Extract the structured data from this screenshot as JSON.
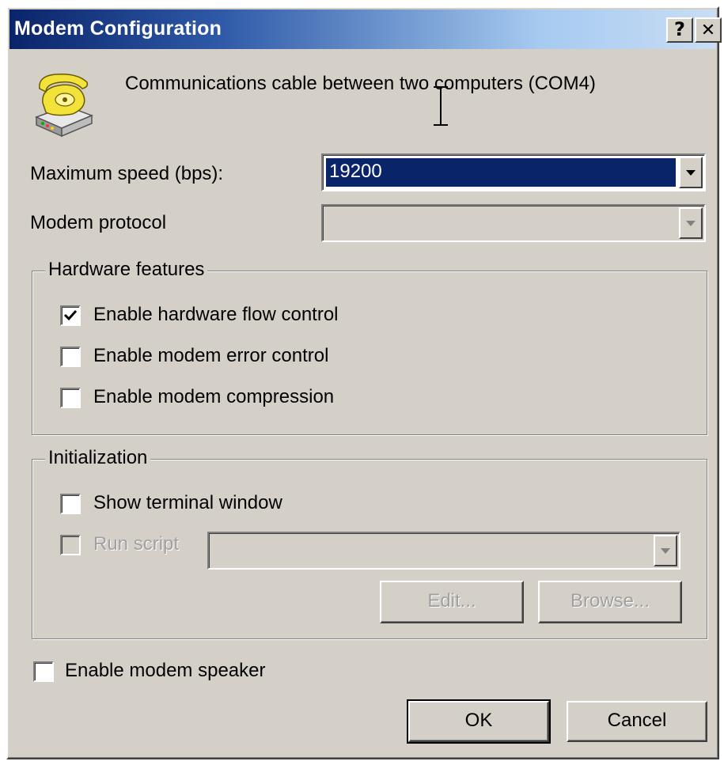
{
  "window": {
    "title": "Modem Configuration",
    "help_label": "?",
    "close_label": "✕"
  },
  "header": {
    "icon": "telephone-modem-icon",
    "description": "Communications cable between two computers (COM4)"
  },
  "speed": {
    "label": "Maximum speed (bps):",
    "value": "19200"
  },
  "protocol": {
    "label": "Modem protocol",
    "value": ""
  },
  "hardware": {
    "title": "Hardware features",
    "items": [
      {
        "label": "Enable hardware flow control",
        "checked": true
      },
      {
        "label": "Enable modem error control",
        "checked": false
      },
      {
        "label": "Enable modem compression",
        "checked": false
      }
    ]
  },
  "initialization": {
    "title": "Initialization",
    "show_terminal_label": "Show terminal window",
    "run_script_label": "Run script",
    "script_value": "",
    "edit_label": "Edit...",
    "browse_label": "Browse..."
  },
  "speaker": {
    "label": "Enable modem speaker"
  },
  "buttons": {
    "ok_label": "OK",
    "cancel_label": "Cancel"
  },
  "colors": {
    "selection": "#0a246a",
    "face": "#d4d0c8"
  }
}
